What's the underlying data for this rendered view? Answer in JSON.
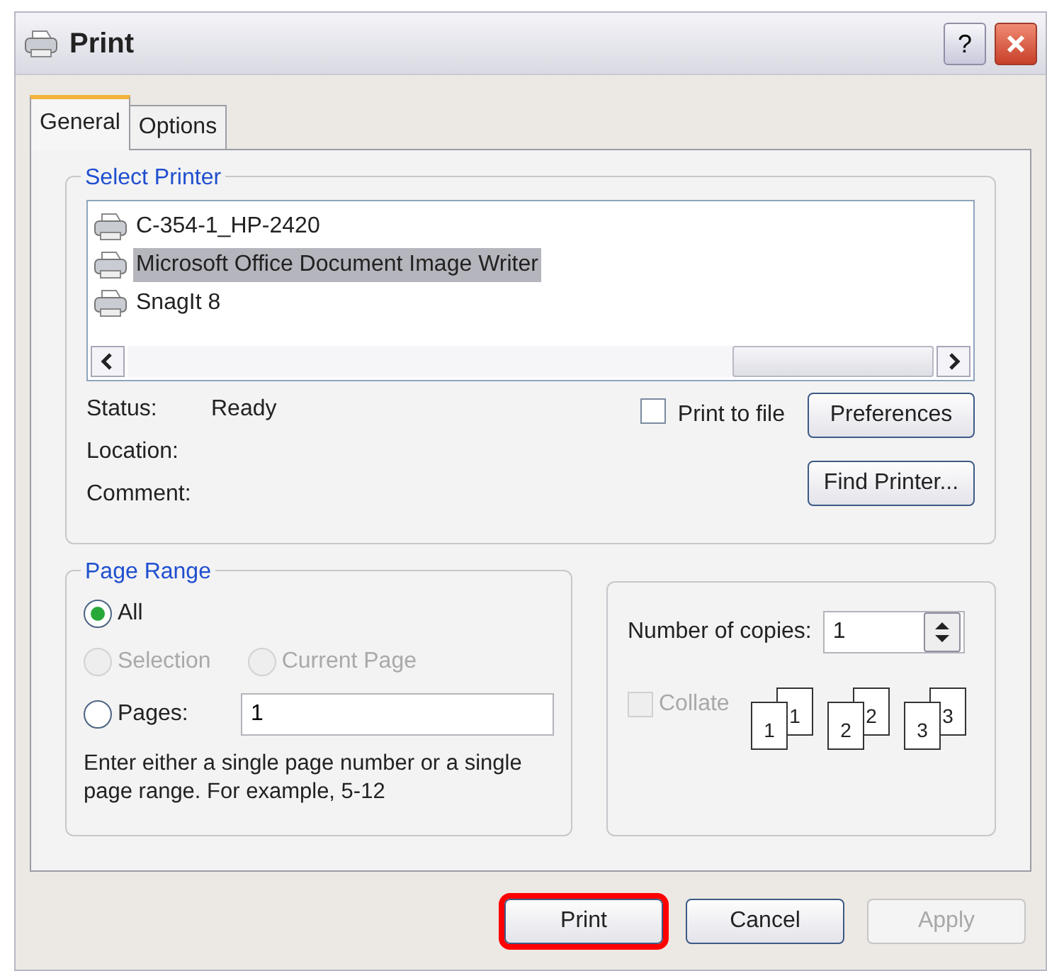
{
  "window": {
    "title": "Print",
    "help_label": "?"
  },
  "tabs": [
    {
      "label": "General",
      "selected": true
    },
    {
      "label": "Options",
      "selected": false
    }
  ],
  "select_printer": {
    "legend": "Select Printer",
    "printers": [
      {
        "name": "C-354-1_HP-2420",
        "selected": false
      },
      {
        "name": "Microsoft Office Document Image Writer",
        "selected": true
      },
      {
        "name": "SnagIt 8",
        "selected": false
      }
    ],
    "status_label": "Status:",
    "status": "Ready",
    "location_label": "Location:",
    "comment_label": "Comment:",
    "print_to_file": {
      "label": "Print to file",
      "checked": false
    },
    "buttons": [
      "Preferences",
      "Find Printer..."
    ]
  },
  "page_range": {
    "legend": "Page Range",
    "options": [
      {
        "label": "All",
        "selected": true,
        "disabled": false
      },
      {
        "label": "Selection",
        "selected": false,
        "disabled": true
      },
      {
        "label": "Current Page",
        "selected": false,
        "disabled": true
      },
      {
        "label": "Pages:",
        "selected": false,
        "disabled": false
      }
    ],
    "pages_value": "1",
    "hint": "Enter either a single page number or a single page range.  For example, 5-12"
  },
  "copies": {
    "label": "Number of copies:",
    "value": "1",
    "collate": {
      "label": "Collate",
      "checked": false,
      "disabled": true
    },
    "stacks": [
      {
        "front": "1",
        "back": "1"
      },
      {
        "front": "2",
        "back": "2"
      },
      {
        "front": "3",
        "back": "3"
      }
    ]
  },
  "buttons": [
    {
      "label": "Print",
      "disabled": false,
      "highlighted": true
    },
    {
      "label": "Cancel",
      "disabled": false,
      "highlighted": false
    },
    {
      "label": "Apply",
      "disabled": true,
      "highlighted": false
    }
  ]
}
